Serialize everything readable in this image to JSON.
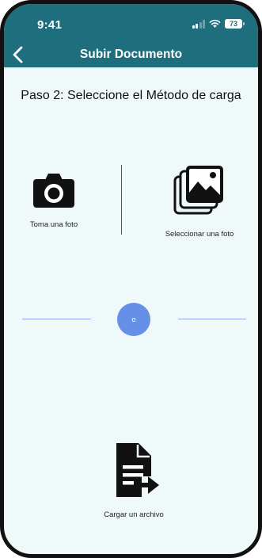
{
  "status_bar": {
    "time": "9:41",
    "battery": "73",
    "icons": [
      "signal-icon",
      "wifi-icon",
      "battery-icon"
    ]
  },
  "header": {
    "title": "Subir Documento",
    "back_icon": "chevron-left-icon",
    "background": "#1f6e7e"
  },
  "step": {
    "title": "Paso 2: Seleccione el Método de carga"
  },
  "options": {
    "camera": {
      "label": "Toma una foto",
      "icon": "camera-icon"
    },
    "gallery": {
      "label": "Seleccionar una foto",
      "icon": "gallery-icon"
    }
  },
  "separator": {
    "label": "o",
    "color": "#6690e8"
  },
  "upload": {
    "label": "Cargar un archivo",
    "icon": "file-upload-icon"
  }
}
